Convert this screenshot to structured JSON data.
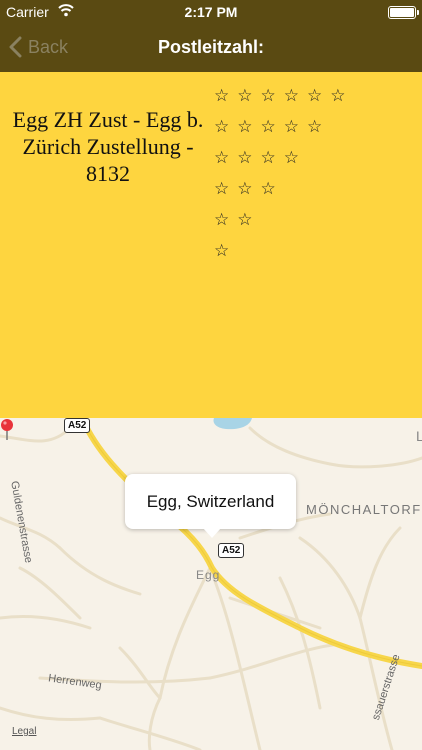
{
  "status_bar": {
    "carrier": "Carrier",
    "time": "2:17 PM"
  },
  "nav": {
    "back_label": "Back",
    "title": "Postleitzahl:"
  },
  "detail": {
    "place_text": "Egg ZH Zust - Egg b. Zürich Zustellung - 8132",
    "star_rows": [
      "☆☆☆☆☆☆",
      "☆☆☆☆☆",
      "☆☆☆☆",
      "☆☆☆",
      "☆☆",
      "☆"
    ]
  },
  "map": {
    "callout": "Egg, Switzerland",
    "road_labels": {
      "a52_top": "A52",
      "a52_egg": "A52",
      "guldenenstrasse": "Guldenenstrasse",
      "herrenweg": "Herrenweg",
      "strasse_right": "ssauerstrasse"
    },
    "town_label": "MÖNCHALTORF",
    "egg_label": "Egg",
    "edge_label": "L",
    "legal": "Legal"
  },
  "colors": {
    "nav_bar": "#5a4a12",
    "panel": "#fed53f",
    "road_major": "#f7d64a"
  }
}
